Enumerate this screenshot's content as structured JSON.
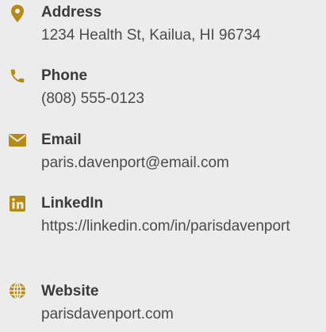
{
  "accent_color": "#b38b16",
  "contact": {
    "address": {
      "icon": "map-marker-icon",
      "label": "Address",
      "value": "1234 Health St, Kailua, HI 96734"
    },
    "phone": {
      "icon": "phone-icon",
      "label": "Phone",
      "value": "(808) 555-0123"
    },
    "email": {
      "icon": "envelope-icon",
      "label": "Email",
      "value": "paris.davenport@email.com"
    },
    "linkedin": {
      "icon": "linkedin-icon",
      "label": "LinkedIn",
      "value": "https://linkedin.com/in/parisdavenport"
    },
    "website": {
      "icon": "globe-icon",
      "label": "Website",
      "value": "parisdavenport.com"
    }
  }
}
